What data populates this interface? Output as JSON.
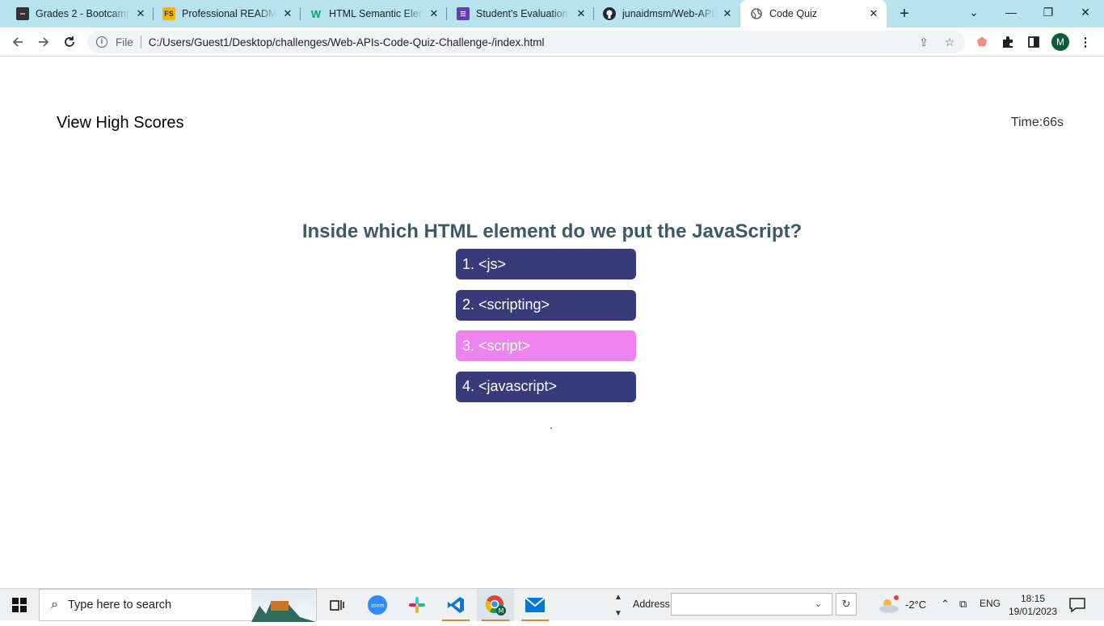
{
  "browser": {
    "tabs": [
      {
        "title": "Grades 2 - Bootcamp",
        "icon": "bootcamp-icon"
      },
      {
        "title": "Professional README",
        "icon": "fs-icon"
      },
      {
        "title": "HTML Semantic Eleme",
        "icon": "w3-icon"
      },
      {
        "title": "Student's Evaluation o",
        "icon": "form-icon"
      },
      {
        "title": "junaidmsm/Web-APIs",
        "icon": "github-icon"
      },
      {
        "title": "Code Quiz",
        "icon": "globe-icon",
        "active": true
      }
    ],
    "address": {
      "scheme_label": "File",
      "url": "C:/Users/Guest1/Desktop/challenges/Web-APIs-Code-Quiz-Challenge-/index.html"
    },
    "profile_initial": "M"
  },
  "quiz": {
    "high_scores_label": "View High Scores",
    "timer_label": "Time:66s",
    "question": "Inside which HTML element do we put the JavaScript?",
    "answers": [
      "1. <js>",
      "2. <scripting>",
      "3. <script>",
      "4. <javascript>"
    ],
    "highlighted_answer_index": 2,
    "colors": {
      "question": "#3a5b63",
      "answer_bg": "#373b7a",
      "answer_hover_bg": "#ee82ee"
    }
  },
  "taskbar": {
    "search_placeholder": "Type here to search",
    "address_label": "Address",
    "temperature": "-2°C",
    "language": "ENG",
    "time": "18:15",
    "date": "19/01/2023"
  }
}
